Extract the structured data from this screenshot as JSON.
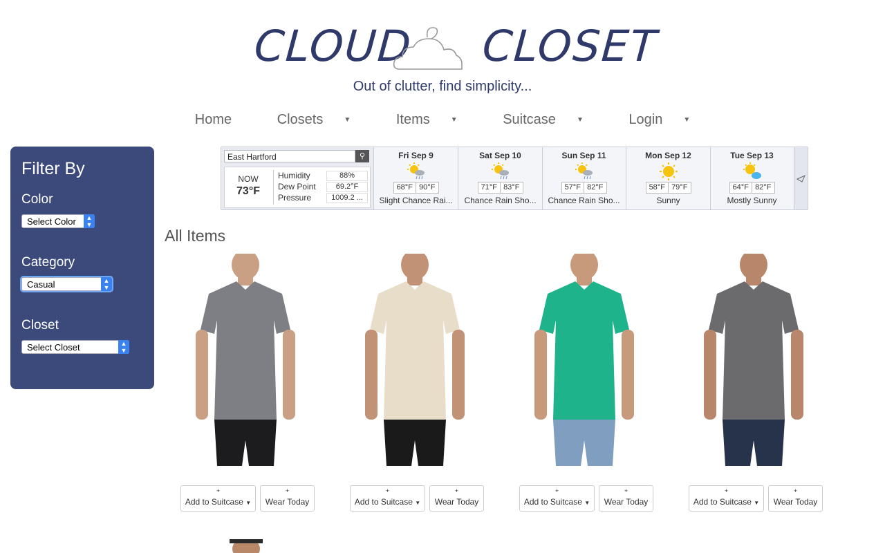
{
  "brand": {
    "left_word": "CLOUD",
    "right_word": "CLOSET",
    "tagline": "Out of clutter, find simplicity..."
  },
  "nav": {
    "items": [
      "Home",
      "Closets",
      "Items",
      "Suitcase",
      "Login"
    ]
  },
  "sidebar": {
    "title": "Filter By",
    "color_label": "Color",
    "color_value": "Select Color",
    "category_label": "Category",
    "category_value": "Casual",
    "closet_label": "Closet",
    "closet_value": "Select Closet"
  },
  "weather": {
    "location": "East Hartford",
    "now_label": "NOW",
    "now_temp": "73°F",
    "humidity_label": "Humidity",
    "humidity_value": "88%",
    "dew_label": "Dew Point",
    "dew_value": "69.2°F",
    "pressure_label": "Pressure",
    "pressure_value": "1009.2 ...",
    "days": [
      {
        "day": "Fri Sep 9",
        "lo": "68°F",
        "hi": "90°F",
        "cond": "Slight Chance Rai...",
        "icon": "sun-cloud-rain-icon"
      },
      {
        "day": "Sat Sep 10",
        "lo": "71°F",
        "hi": "83°F",
        "cond": "Chance Rain Sho...",
        "icon": "sun-cloud-rain-icon"
      },
      {
        "day": "Sun Sep 11",
        "lo": "57°F",
        "hi": "82°F",
        "cond": "Chance Rain Sho...",
        "icon": "sun-cloud-rain-icon"
      },
      {
        "day": "Mon Sep 12",
        "lo": "58°F",
        "hi": "79°F",
        "cond": "Sunny",
        "icon": "sun-icon"
      },
      {
        "day": "Tue Sep 13",
        "lo": "64°F",
        "hi": "82°F",
        "cond": "Mostly Sunny",
        "icon": "sun-cloud-icon"
      }
    ]
  },
  "main": {
    "title": "All Items",
    "items": [
      {
        "shirt_color": "#7e7f84",
        "pants_color": "#1c1c1e",
        "plus": "+",
        "suitcase_label": "Add to Suitcase",
        "wear_label": "Wear Today"
      },
      {
        "shirt_color": "#e7ddc8",
        "pants_color": "#1a1a1a",
        "plus": "+",
        "suitcase_label": "Add to Suitcase",
        "wear_label": "Wear Today"
      },
      {
        "shirt_color": "#1fb38c",
        "pants_color": "#7f9ec0",
        "plus": "+",
        "suitcase_label": "Add to Suitcase",
        "wear_label": "Wear Today"
      },
      {
        "shirt_color": "#6b6b6e",
        "pants_color": "#27334a",
        "plus": "+",
        "suitcase_label": "Add to Suitcase",
        "wear_label": "Wear Today"
      }
    ]
  },
  "colors": {
    "brand": "#2f3a6a",
    "sidebar_bg": "#3b4a7a",
    "select_accent": "#3a82f0"
  }
}
